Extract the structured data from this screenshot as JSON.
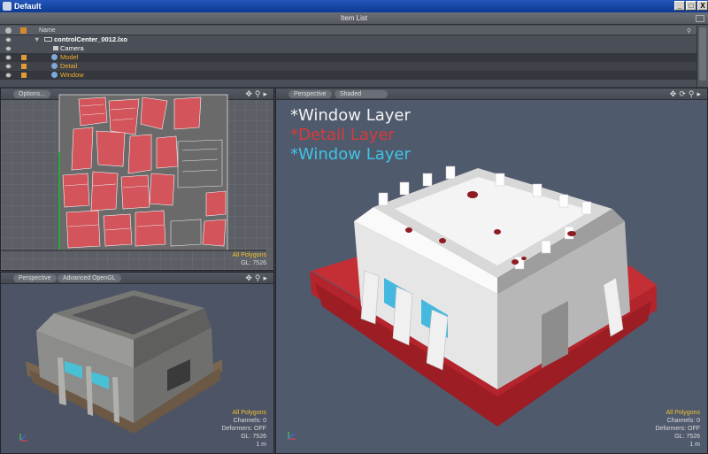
{
  "window": {
    "title": "Default",
    "buttons": {
      "minimize": "_",
      "maximize": "□",
      "close": "X"
    }
  },
  "item_list": {
    "title": "Item List",
    "column_name": "Name",
    "scene_file": "controlCenter_0012.lxo",
    "items": [
      {
        "label": "Camera"
      },
      {
        "label": "Model"
      },
      {
        "label": "Detail"
      },
      {
        "label": "Window"
      }
    ]
  },
  "uv_viewport": {
    "options_label": "Options...",
    "hud_line1": "All Polygons",
    "hud_line2": "GL: 7526"
  },
  "small_viewport": {
    "view_label": "Perspective",
    "shading_label": "Advanced OpenGL",
    "hud": {
      "polygons": "All Polygons",
      "channels": "Channels: 0",
      "deformers": "Deformers: OFF",
      "gl": "GL: 7526",
      "scale": "1 m"
    }
  },
  "main_viewport": {
    "view_label": "Perspective",
    "shading_label": "Shaded",
    "layers": [
      {
        "text": "*Window Layer",
        "color": "#f2f2f2"
      },
      {
        "text": "*Detail Layer",
        "color": "#d73a3a"
      },
      {
        "text": "*Window Layer",
        "color": "#3fc4e6"
      }
    ],
    "hud": {
      "polygons": "All Polygons",
      "channels": "Channels: 0",
      "deformers": "Deformers: OFF",
      "gl": "GL: 7526",
      "scale": "1 m"
    }
  },
  "icons": [
    "app-icon",
    "eye-icon",
    "lock-icon",
    "mesh-icon",
    "camera-icon",
    "move-icon",
    "zoom-icon",
    "rotate-icon",
    "expand-arrow-icon"
  ]
}
